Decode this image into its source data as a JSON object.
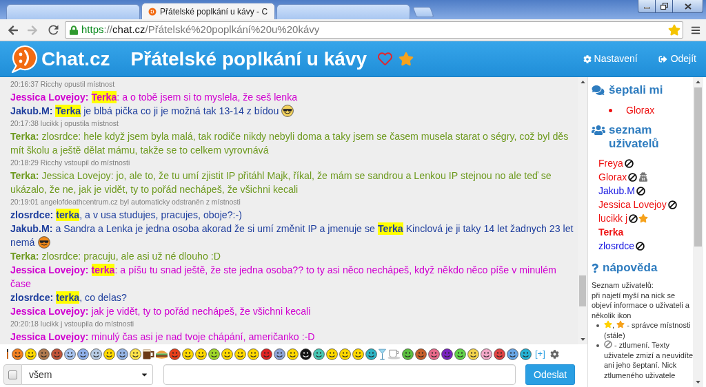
{
  "browser": {
    "tabs": [
      {
        "selected": false
      },
      {
        "title": "Přátelské poplkání u kávy - C",
        "selected": true
      },
      {
        "selected": false
      }
    ],
    "can_go_forward": false,
    "url": [
      {
        "kind": "scheme",
        "text": "https"
      },
      {
        "kind": "dim",
        "text": "://"
      },
      {
        "kind": "host",
        "text": "chat.cz"
      },
      {
        "kind": "dim",
        "text": "/Přátelské%20poplkání%20u%20kávy"
      }
    ],
    "bookmarked": true
  },
  "header": {
    "logo": "Chat.cz",
    "room_title": "Přátelské poplkání u kávy",
    "links": [
      {
        "kind": "settings",
        "label": "Nastavení"
      },
      {
        "kind": "logout",
        "label": "Odejít"
      }
    ]
  },
  "messages": [
    {
      "kind": "system",
      "time": "20:16:37",
      "text": "Ricchy opustil místnost"
    },
    {
      "kind": "chat",
      "nick": "Jessica Lovejoy:",
      "color": "#d000d0",
      "parts": [
        {
          "kind": "highlight",
          "text": "Terka"
        },
        {
          "kind": "text",
          "text": ": a o tobě jsem si to myslela, že seš lenka"
        }
      ]
    },
    {
      "kind": "chat",
      "nick": "Jakub.M:",
      "color": "#1f3f9e",
      "parts": [
        {
          "kind": "highlight",
          "text": "Terka"
        },
        {
          "kind": "text",
          "text": " je blbá pička co ji je možná tak 13-14 z bídou"
        },
        {
          "kind": "emoji_cool"
        }
      ]
    },
    {
      "kind": "system",
      "time": "20:17:38",
      "text": "lucikk j opustila místnost"
    },
    {
      "kind": "chat",
      "nick": "Terka:",
      "color": "#6e9a1f",
      "parts": [
        {
          "kind": "text",
          "text": "zlosrdce: hele když jsem byla malá, tak rodiče nikdy nebyli doma a taky jsem se časem musela starat o ségry, což byl děs mít školu a ještě dělat mámu, takže se to celkem vyrovnává"
        }
      ]
    },
    {
      "kind": "system",
      "time": "20:18:29",
      "text": "Ricchy vstoupil do místnosti"
    },
    {
      "kind": "chat",
      "nick": "Terka:",
      "color": "#6e9a1f",
      "parts": [
        {
          "kind": "text",
          "text": "Jessica Lovejoy: jo, ale to, že tu umí zjistit IP přitáhl Majk, říkal, že mám se sandrou a Lenkou IP stejnou no ale teď se ukázalo, že ne, jak je vidět, ty to pořád nechápeš, že všichni kecali"
        }
      ]
    },
    {
      "kind": "system",
      "time": "20:19:01",
      "text": "angelofdeathcentrum.cz byl automaticky odstraněn z místnosti"
    },
    {
      "kind": "chat",
      "nick": "zlosrdce:",
      "color": "#1f3f9e",
      "parts": [
        {
          "kind": "highlight",
          "text": "terka"
        },
        {
          "kind": "text",
          "text": ", a v usa studujes, pracujes, oboje?:-)"
        }
      ]
    },
    {
      "kind": "chat",
      "nick": "Jakub.M:",
      "color": "#1f3f9e",
      "parts": [
        {
          "kind": "text",
          "text": "a Sandra a Lenka je jedna osoba akorad že si umí změnit IP a jmenuje se "
        },
        {
          "kind": "highlight",
          "text": "Terka"
        },
        {
          "kind": "text",
          "text": " Kinclová je ji taky 14 let žadnych 23 let nemá"
        },
        {
          "kind": "emoji_smoker"
        }
      ]
    },
    {
      "kind": "chat",
      "nick": "Terka:",
      "color": "#6e9a1f",
      "parts": [
        {
          "kind": "text",
          "text": "zlosrdce: pracuju, ale asi už né dlouho :D"
        }
      ]
    },
    {
      "kind": "chat",
      "nick": "Jessica Lovejoy:",
      "color": "#d000d0",
      "parts": [
        {
          "kind": "highlight",
          "text": "terka"
        },
        {
          "kind": "text",
          "text": ": a píšu tu snad ještě, že ste jedna osoba?? to ty asi něco nechápeš, když někdo něco píše v minulém čase"
        }
      ]
    },
    {
      "kind": "chat",
      "nick": "zlosrdce:",
      "color": "#1f3f9e",
      "parts": [
        {
          "kind": "highlight",
          "text": "terka"
        },
        {
          "kind": "text",
          "text": ", co delas?"
        }
      ]
    },
    {
      "kind": "chat",
      "nick": "Jessica Lovejoy:",
      "color": "#d000d0",
      "parts": [
        {
          "kind": "text",
          "text": "jak je vidět, ty to pořád nechápeš, že všichni kecali"
        }
      ]
    },
    {
      "kind": "system",
      "time": "20:20:18",
      "text": "lucikk j vstoupila do místnosti"
    },
    {
      "kind": "chat",
      "nick": "Jessica Lovejoy:",
      "color": "#d000d0",
      "parts": [
        {
          "kind": "text",
          "text": "minulý čas asi je nad tvoje chápání, američanko :-D"
        }
      ]
    }
  ],
  "composer": {
    "more_emoji": "[+]",
    "private": {
      "checked": false
    },
    "recipient": "všem",
    "send_button": "Odeslat"
  },
  "sidebar": {
    "whispers": {
      "title": "šeptali mi",
      "items": [
        {
          "name": "Glorax",
          "color": "#ee1111"
        }
      ]
    },
    "users": {
      "title": "seznam uživatelů",
      "items": [
        {
          "name": "Freya",
          "color": "#ee1111",
          "self": false,
          "mute": true,
          "incognito": false,
          "admin": false
        },
        {
          "name": "Glorax",
          "color": "#ee1111",
          "self": false,
          "mute": true,
          "incognito": true,
          "admin": false
        },
        {
          "name": "Jakub.M",
          "color": "#1414e0",
          "self": false,
          "mute": true,
          "incognito": false,
          "admin": false
        },
        {
          "name": "Jessica Lovejoy",
          "color": "#ee1111",
          "self": false,
          "mute": true,
          "incognito": false,
          "admin": false
        },
        {
          "name": "lucikk j",
          "color": "#ee1111",
          "self": false,
          "mute": true,
          "incognito": false,
          "admin": true
        },
        {
          "name": "Terka",
          "color": "#ee1111",
          "self": true,
          "mute": false,
          "incognito": false,
          "admin": false
        },
        {
          "name": "zlosrdce",
          "color": "#1414e0",
          "self": false,
          "mute": true,
          "incognito": false,
          "admin": false
        }
      ]
    },
    "help": {
      "title": "nápověda",
      "heading": "Seznam uživatelů:",
      "text": "při najetí myší na nick se objeví informace o uživateli a několik ikon",
      "items": [
        {
          "kind": "admin",
          "separator": ",",
          "text": "- správce místnosti (stále)"
        },
        {
          "kind": "mute",
          "text": "- ztlumení. Texty uživatele zmizí a neuvidíte ani jeho šeptaní. Nick ztlumeného uživatele"
        }
      ]
    }
  }
}
